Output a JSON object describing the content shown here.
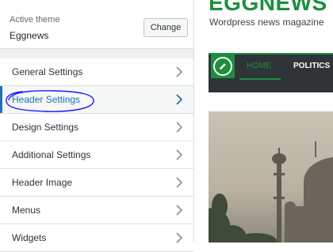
{
  "theme": {
    "caption": "Active theme",
    "name": "Eggnews",
    "change_label": "Change"
  },
  "menu": {
    "items": [
      {
        "label": "General Settings"
      },
      {
        "label": "Header Settings",
        "active": true
      },
      {
        "label": "Design Settings"
      },
      {
        "label": "Additional Settings"
      },
      {
        "label": "Header Image"
      },
      {
        "label": "Menus"
      },
      {
        "label": "Widgets"
      }
    ],
    "chevron_icon": "chevron-right-icon"
  },
  "preview": {
    "site_title": "EGGNEWS",
    "tagline": "Wordpress news magazine",
    "nav": {
      "home": "HOME",
      "politics": "POLITICS"
    },
    "edit_icon": "pencil-icon"
  },
  "colors": {
    "accent_green": "#1e8e3e",
    "active_blue": "#2271b1",
    "nav_dark": "#2f3439",
    "annotation": "#1a1aff"
  }
}
